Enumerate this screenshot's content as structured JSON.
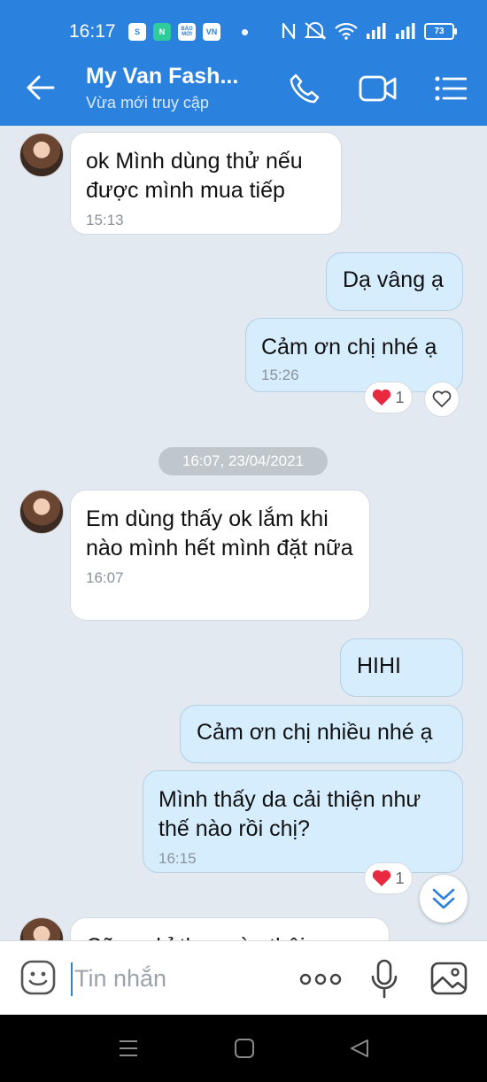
{
  "status_bar": {
    "time": "16:17",
    "app_icons": [
      "S",
      "N",
      "BÁO MỚI",
      "VN"
    ],
    "battery": "73"
  },
  "header": {
    "title": "My Van Fash...",
    "subtitle": "Vừa mới truy cập"
  },
  "messages": [
    {
      "dir": "in",
      "text": "ok Mình dùng thử nếu được mình mua tiếp",
      "time": "15:13"
    },
    {
      "dir": "out",
      "text": "Dạ vâng ạ"
    },
    {
      "dir": "out",
      "text": "Cảm ơn chị nhé ạ",
      "time": "15:26",
      "reaction_count": "1"
    },
    {
      "dir": "in",
      "text": "Em dùng thấy ok lắm khi nào mình hết mình đặt nữa",
      "time": "16:07"
    },
    {
      "dir": "out",
      "text": "HIHI"
    },
    {
      "dir": "out",
      "text": "Cảm ơn chị nhiều nhé ạ"
    },
    {
      "dir": "out",
      "text": "Mình thấy da cải thiện như thế nào rồi chị?",
      "time": "16:15",
      "reaction_count": "1"
    },
    {
      "dir": "in",
      "text": "Cũng chỉ thay vào thôi"
    }
  ],
  "date_separator": "16:07, 23/04/2021",
  "input": {
    "placeholder": "Tin nhắn"
  },
  "icons": {
    "back": "arrow-left-icon",
    "call": "phone-icon",
    "video": "video-camera-icon",
    "menu": "list-menu-icon",
    "emoji": "sticker-icon",
    "more": "more-dots-icon",
    "mic": "microphone-icon",
    "image": "image-icon",
    "scroll": "chevron-double-down-icon",
    "reaction": "heart-icon"
  },
  "colors": {
    "brand": "#2b81de",
    "outgoing_bubble": "#d5edfd",
    "incoming_bubble": "#ffffff",
    "chat_background": "#e2e9f1",
    "heart": "#e8293f"
  }
}
